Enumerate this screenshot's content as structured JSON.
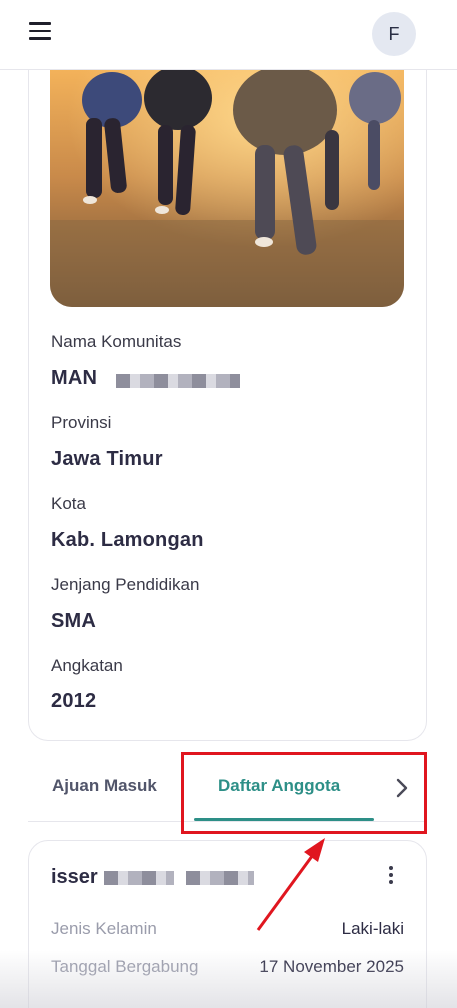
{
  "header": {
    "menu_icon": "hamburger-menu-icon",
    "avatar_initial": "F"
  },
  "community": {
    "photo_alt": "people-running-photo",
    "fields": [
      {
        "label": "Nama Komunitas",
        "value": "MAN"
      },
      {
        "label": "Provinsi",
        "value": "Jawa Timur"
      },
      {
        "label": "Kota",
        "value": "Kab. Lamongan"
      },
      {
        "label": "Jenjang Pendidikan",
        "value": "SMA"
      },
      {
        "label": "Angkatan",
        "value": "2012"
      }
    ]
  },
  "tabs": {
    "items": [
      {
        "label": "Ajuan Masuk",
        "active": false
      },
      {
        "label": "Daftar Anggota",
        "active": true
      }
    ],
    "next_icon": "chevron-right-icon",
    "accent_color": "#2d8f87"
  },
  "member": {
    "name": "isser",
    "menu_icon": "more-vertical-icon",
    "rows": [
      {
        "label": "Jenis Kelamin",
        "value": "Laki-laki"
      },
      {
        "label": "Tanggal Bergabung",
        "value": "17 November 2025"
      }
    ]
  },
  "annotation": {
    "highlight_color": "#e0161f"
  }
}
